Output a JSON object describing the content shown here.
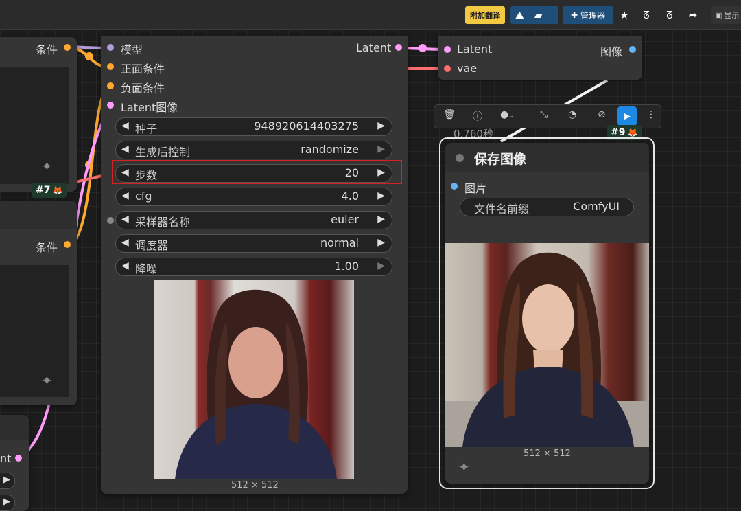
{
  "topbar": {
    "translate_label": "附加翻译",
    "manager_label": "管理器",
    "show_label": "显示"
  },
  "left_node_top": {
    "output_label": "条件"
  },
  "left_node_mid": {
    "output_label": "条件",
    "badge": "#7"
  },
  "left_node_bottom": {
    "output_label": "nt"
  },
  "sampler": {
    "inputs": [
      "模型",
      "正面条件",
      "负面条件",
      "Latent图像"
    ],
    "output_label": "Latent",
    "widgets": [
      {
        "label": "种子",
        "value": "948920614403275"
      },
      {
        "label": "生成后控制",
        "value": "randomize"
      },
      {
        "label": "步数",
        "value": "20"
      },
      {
        "label": "cfg",
        "value": "4.0"
      },
      {
        "label": "采样器名称",
        "value": "euler"
      },
      {
        "label": "调度器",
        "value": "normal"
      },
      {
        "label": "降噪",
        "value": "1.00"
      }
    ],
    "image_size": "512 × 512"
  },
  "vae_node": {
    "inputs": [
      "Latent",
      "vae"
    ],
    "output_label": "图像"
  },
  "node_toolbar": {
    "icons": [
      "trash-icon",
      "info-icon",
      "color-icon",
      "collapse-icon",
      "bypass-icon",
      "mute-icon",
      "run-icon",
      "more-icon"
    ]
  },
  "save_node": {
    "timing": "0.760秒",
    "badge": "#9",
    "title": "保存图像",
    "input_label": "图片",
    "widget_label": "文件名前缀",
    "widget_value": "ComfyUI",
    "image_size": "512 × 512"
  },
  "colors": {
    "model_dot": "#b39ddb",
    "cond_dot": "#ffa931",
    "latent_dot": "#ff9cf9",
    "vae_dot": "#ff6e6e",
    "image_dot": "#64b5f6",
    "highlight": "#d72020"
  }
}
